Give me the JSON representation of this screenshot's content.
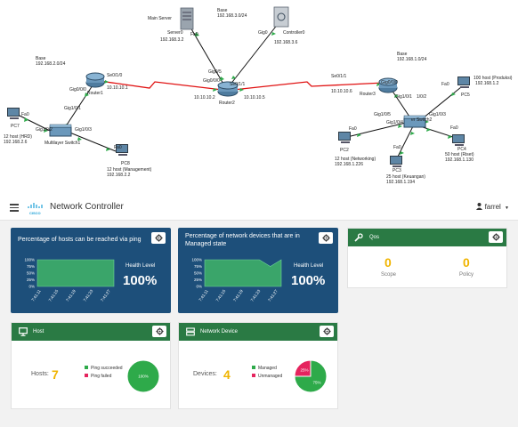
{
  "topology": {
    "labels": {
      "main_server": "Main Server",
      "server_name": "Server0",
      "server_port": "Fa0",
      "server_ip": "192.168.3.2",
      "base3": "Base",
      "base3_net": "192.168.3.0/24",
      "ctrl_port": "Gig0",
      "ctrl_name": "Controller0",
      "ctrl_ip": "192.168.3.6",
      "base2": "Base",
      "base2_net": "192.168.2.0/24",
      "base1": "Base",
      "base1_net": "192.168.1.0/24",
      "r1_se": "Se0/1/0",
      "r1_ip": "10.10.10.1",
      "r1_gig": "Gig0/0/0",
      "r1_name": "Router1",
      "r2_gig05": "Gig0/5",
      "r2_gig0": "Gig0/0/0",
      "r2_se": "Se0/1/1",
      "r2_ip_left": "10.10.10.2",
      "r2_name": "Router2",
      "r2_ip_right": "10.10.10.5",
      "r3_se": "Se0/1/1",
      "r3_ip": "10.10.10.6",
      "r3_gig": "Gig0/0/0",
      "r3_name": "Router3",
      "msw1_gig_a": "Gig1/0/1",
      "msw1_gig_b": "Gig1/0/2",
      "msw1_gig_c": "Gig1/0/3",
      "msw1_name": "Multilayer Switch1",
      "pc7_fa": "Fa0",
      "pc7_name": "PC7",
      "pc7_desc": "12 host (HRD)",
      "pc7_ip": "192.168.2.6",
      "pc8_fa": "Fa0",
      "pc8_name": "PC8",
      "pc8_desc": "12 host (Management)",
      "pc8_ip": "192.168.2.2",
      "msw2_gig10": "Gig1/0/1",
      "msw2_gig2": "1/0/2",
      "msw2_name": "er Switch2",
      "msw2_gig5": "Gig1/0/5",
      "msw2_gig4": "Gig1/0/4",
      "msw2_gig3": "Gig1/0/3",
      "pc5_fa": "Fa0",
      "pc5_name": "PC5",
      "pc5_desc": "100 host (Produksi)",
      "pc5_ip": "192.168.1.2",
      "pc2_fa": "Fa0",
      "pc2_name": "PC2",
      "pc2_desc": "12 host (Networking)",
      "pc2_ip": "192.168.1.226",
      "pc3_fa": "Fa0",
      "pc3_name": "PC3",
      "pc3_desc": "25 host (Keuangan)",
      "pc3_ip": "192.168.1.194",
      "pc4_fa": "Fa0",
      "pc4_name": "PC4",
      "pc4_desc": "50 host (Riset)",
      "pc4_ip": "192.168.1.130"
    }
  },
  "controller": {
    "logo_text": "CISCO",
    "title": "Network Controller",
    "user": "farrel",
    "hosts_ping_card": {
      "title": "Percentage of hosts can be reached via ping",
      "y_ticks": [
        "100%",
        "75%",
        "50%",
        "25%",
        "0%"
      ],
      "x_ticks": [
        "7:41:11",
        "7:41:15",
        "7:41:19",
        "7:41:23",
        "7:41:27"
      ],
      "health_label": "Health Level",
      "health_value": "100%",
      "series": [
        100,
        100,
        100,
        100,
        100,
        100,
        100
      ]
    },
    "devices_card": {
      "title": "Percentage of network devices that are in Managed state",
      "y_ticks": [
        "100%",
        "75%",
        "50%",
        "25%",
        "0%"
      ],
      "x_ticks": [
        "7:41:11",
        "7:41:15",
        "7:41:19",
        "7:41:23",
        "7:41:27"
      ],
      "health_label": "Health Level",
      "health_value": "100%",
      "series": [
        100,
        100,
        100,
        100,
        100,
        100,
        75,
        100
      ]
    },
    "qos_card": {
      "title": "Qos",
      "scope_value": "0",
      "scope_label": "Scope",
      "policy_value": "0",
      "policy_label": "Policy"
    },
    "host_card": {
      "title": "Host",
      "count_label": "Hosts:",
      "count": "7",
      "legend": [
        {
          "label": "Ping succeeded",
          "color": "#2eaa4a"
        },
        {
          "label": "Ping failed",
          "color": "#e5245e"
        }
      ],
      "pie": [
        {
          "value": 100,
          "color": "#2eaa4a",
          "label": "100%"
        }
      ]
    },
    "device_card": {
      "title": "Network Device",
      "count_label": "Devices:",
      "count": "4",
      "legend": [
        {
          "label": "Managed",
          "color": "#2eaa4a"
        },
        {
          "label": "Unmanaged",
          "color": "#e5245e"
        }
      ],
      "pie": [
        {
          "value": 75,
          "color": "#2eaa4a",
          "label": "75%"
        },
        {
          "value": 25,
          "color": "#e5245e",
          "label": "25%"
        }
      ]
    }
  },
  "colors": {
    "dark_blue": "#1d4f7a",
    "green_header": "#2a7a44",
    "accent_number": "#f0b400",
    "serial_link": "#e01010"
  }
}
